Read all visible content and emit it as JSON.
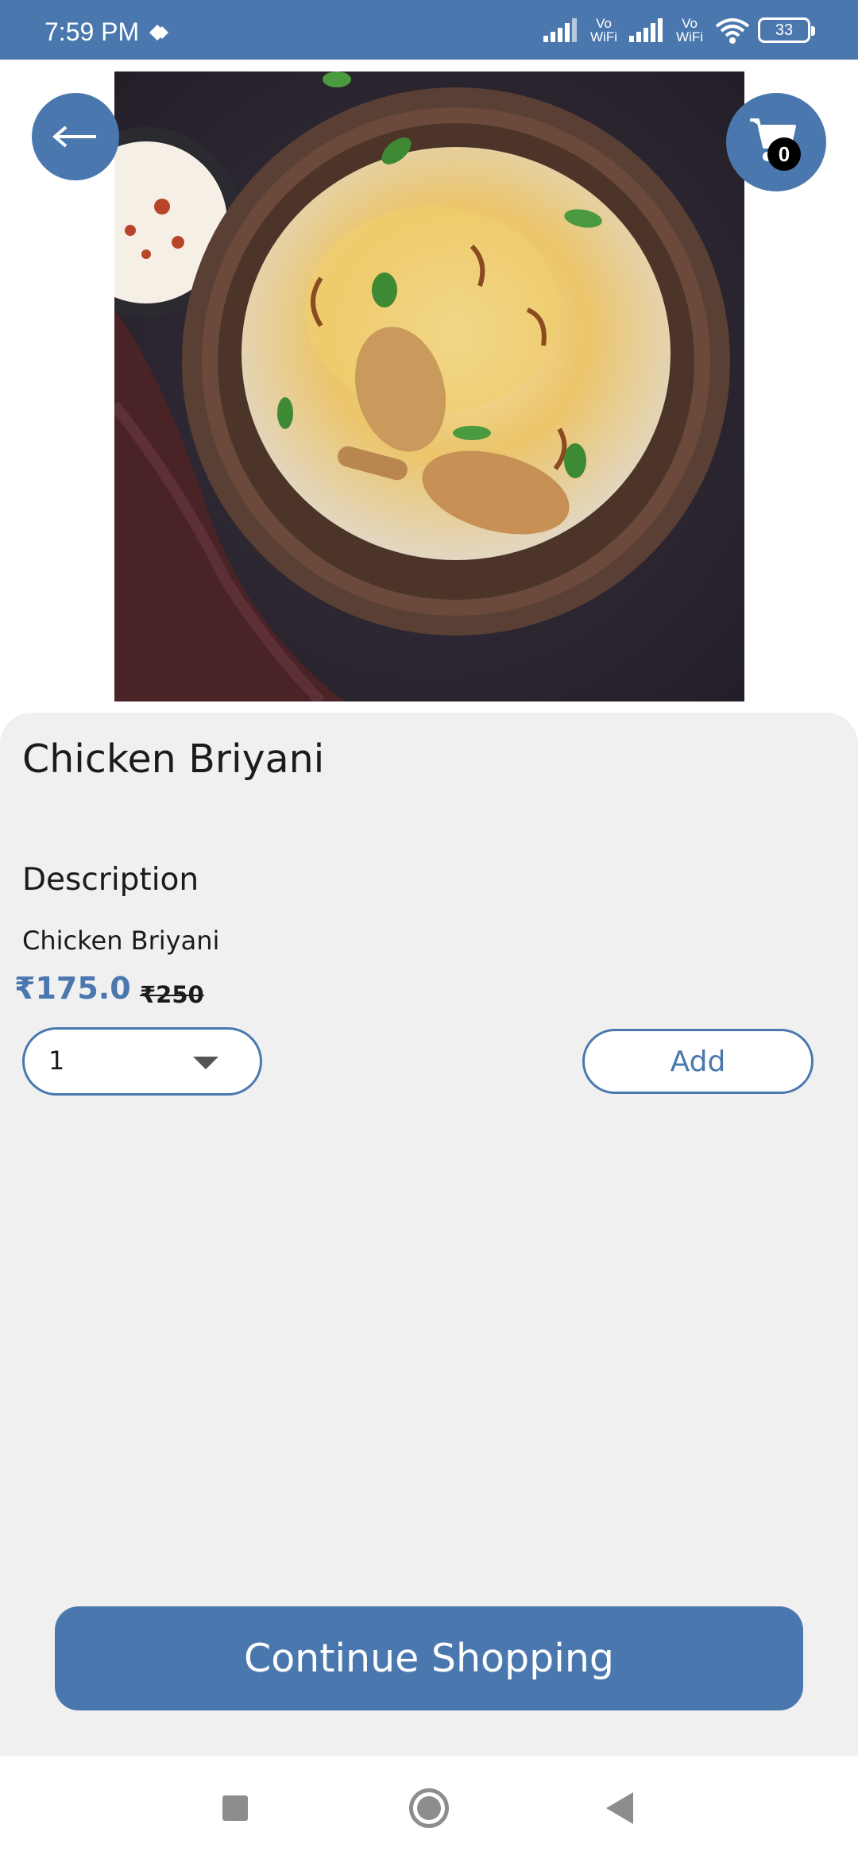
{
  "status_bar": {
    "time": "7:59 PM",
    "vowifi_1": "Vo WiFi",
    "vowifi_2": "Vo WiFi",
    "battery": "33"
  },
  "header": {
    "back_icon": "arrow-left-icon",
    "cart_icon": "shopping-cart-icon",
    "cart_count": "0"
  },
  "product": {
    "image_alt": "biryani-photo",
    "title": "Chicken Briyani",
    "description_heading": "Description",
    "description": "Chicken Briyani",
    "price": "₹175.0",
    "mrp": "₹250",
    "quantity": "1",
    "add_label": "Add"
  },
  "footer": {
    "continue_label": "Continue Shopping"
  },
  "colors": {
    "accent": "#4a78ae",
    "sheet_bg": "#f0f0f0"
  }
}
